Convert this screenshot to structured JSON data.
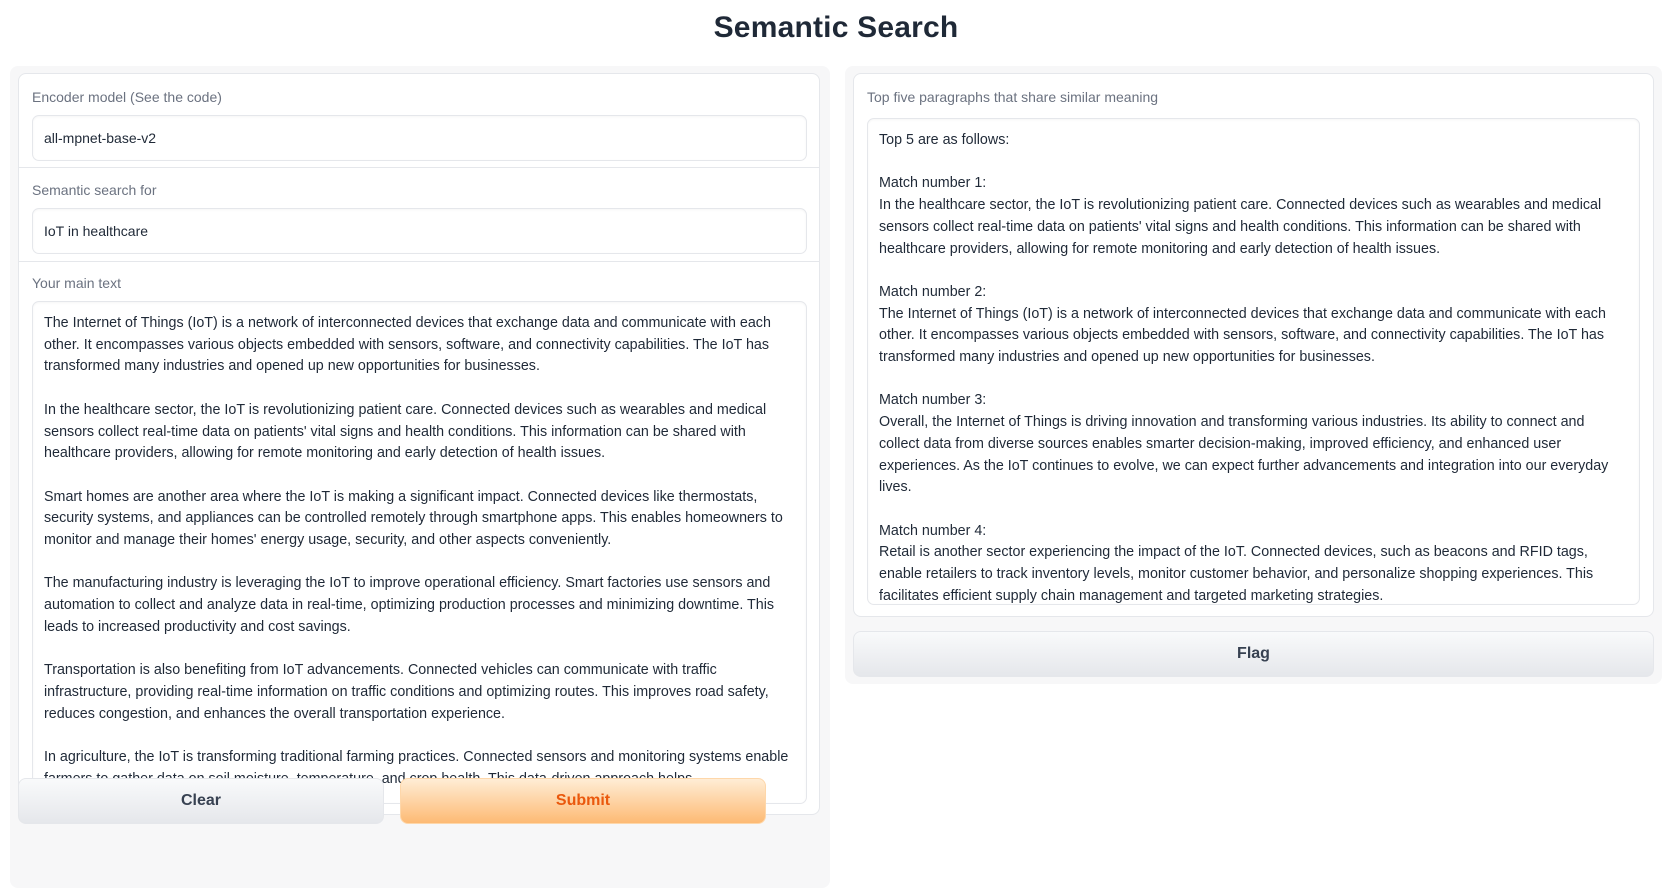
{
  "app": {
    "title": "Semantic Search"
  },
  "inputs": {
    "encoder": {
      "label": "Encoder model (See the code)",
      "value": "all-mpnet-base-v2"
    },
    "query": {
      "label": "Semantic search for",
      "value": "IoT in healthcare"
    },
    "main_text": {
      "label": "Your main text",
      "value": "The Internet of Things (IoT) is a network of interconnected devices that exchange data and communicate with each other. It encompasses various objects embedded with sensors, software, and connectivity capabilities. The IoT has transformed many industries and opened up new opportunities for businesses.\n\nIn the healthcare sector, the IoT is revolutionizing patient care. Connected devices such as wearables and medical sensors collect real-time data on patients' vital signs and health conditions. This information can be shared with healthcare providers, allowing for remote monitoring and early detection of health issues.\n\nSmart homes are another area where the IoT is making a significant impact. Connected devices like thermostats, security systems, and appliances can be controlled remotely through smartphone apps. This enables homeowners to monitor and manage their homes' energy usage, security, and other aspects conveniently.\n\nThe manufacturing industry is leveraging the IoT to improve operational efficiency. Smart factories use sensors and automation to collect and analyze data in real-time, optimizing production processes and minimizing downtime. This leads to increased productivity and cost savings.\n\nTransportation is also benefiting from IoT advancements. Connected vehicles can communicate with traffic infrastructure, providing real-time information on traffic conditions and optimizing routes. This improves road safety, reduces congestion, and enhances the overall transportation experience.\n\nIn agriculture, the IoT is transforming traditional farming practices. Connected sensors and monitoring systems enable farmers to gather data on soil moisture, temperature, and crop health. This data-driven approach helps"
    }
  },
  "buttons": {
    "clear_label": "Clear",
    "submit_label": "Submit",
    "flag_label": "Flag"
  },
  "output": {
    "label": "Top five paragraphs that share similar meaning",
    "value": "Top 5 are as follows:\n\nMatch number 1:\nIn the healthcare sector, the IoT is revolutionizing patient care. Connected devices such as wearables and medical sensors collect real-time data on patients' vital signs and health conditions. This information can be shared with healthcare providers, allowing for remote monitoring and early detection of health issues.\n\nMatch number 2:\nThe Internet of Things (IoT) is a network of interconnected devices that exchange data and communicate with each other. It encompasses various objects embedded with sensors, software, and connectivity capabilities. The IoT has transformed many industries and opened up new opportunities for businesses.\n\nMatch number 3:\nOverall, the Internet of Things is driving innovation and transforming various industries. Its ability to connect and collect data from diverse sources enables smarter decision-making, improved efficiency, and enhanced user experiences. As the IoT continues to evolve, we can expect further advancements and integration into our everyday lives.\n\nMatch number 4:\nRetail is another sector experiencing the impact of the IoT. Connected devices, such as beacons and RFID tags, enable retailers to track inventory levels, monitor customer behavior, and personalize shopping experiences. This facilitates efficient supply chain management and targeted marketing strategies."
  },
  "colors": {
    "accent": "#ea580c",
    "primary_button_top": "#ffedd5",
    "primary_button_bottom": "#fdba74",
    "panel_background": "#f7f7f8",
    "border": "#e5e7eb",
    "label": "#6b7280",
    "text": "#1f2937"
  }
}
